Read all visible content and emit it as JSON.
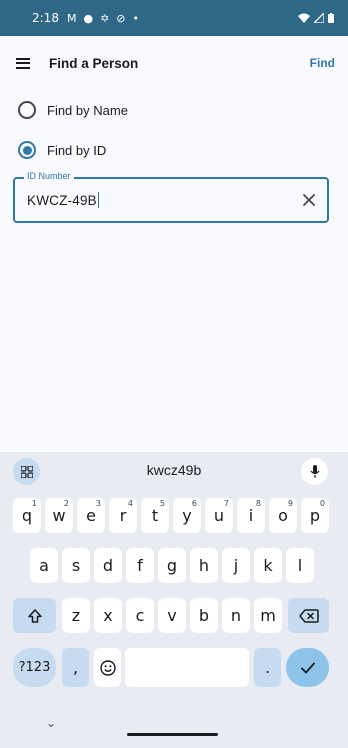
{
  "status_bar": {
    "time": "2:18",
    "left_icons": [
      "gmail-icon",
      "keyhole-icon",
      "fan-icon",
      "blocked-icon",
      "dot-icon"
    ],
    "right_icons": [
      "wifi-icon",
      "signal-icon",
      "battery-icon"
    ]
  },
  "app_bar": {
    "title": "Find a Person",
    "action": "Find"
  },
  "search_mode": {
    "options": [
      {
        "label": "Find by Name",
        "selected": false
      },
      {
        "label": "Find by ID",
        "selected": true
      }
    ]
  },
  "id_field": {
    "label": "ID Number",
    "value": "KWCZ-49B"
  },
  "keyboard": {
    "suggestion": "kwcz49b",
    "row1": [
      {
        "key": "q",
        "hint": "1"
      },
      {
        "key": "w",
        "hint": "2"
      },
      {
        "key": "e",
        "hint": "3"
      },
      {
        "key": "r",
        "hint": "4"
      },
      {
        "key": "t",
        "hint": "5"
      },
      {
        "key": "y",
        "hint": "6"
      },
      {
        "key": "u",
        "hint": "7"
      },
      {
        "key": "i",
        "hint": "8"
      },
      {
        "key": "o",
        "hint": "9"
      },
      {
        "key": "p",
        "hint": "0"
      }
    ],
    "row2": [
      "a",
      "s",
      "d",
      "f",
      "g",
      "h",
      "j",
      "k",
      "l"
    ],
    "row3": [
      "z",
      "x",
      "c",
      "v",
      "b",
      "n",
      "m"
    ],
    "symbols_key": "?123",
    "comma_key": ",",
    "period_key": ".",
    "accent_color": "#2f78a9"
  }
}
